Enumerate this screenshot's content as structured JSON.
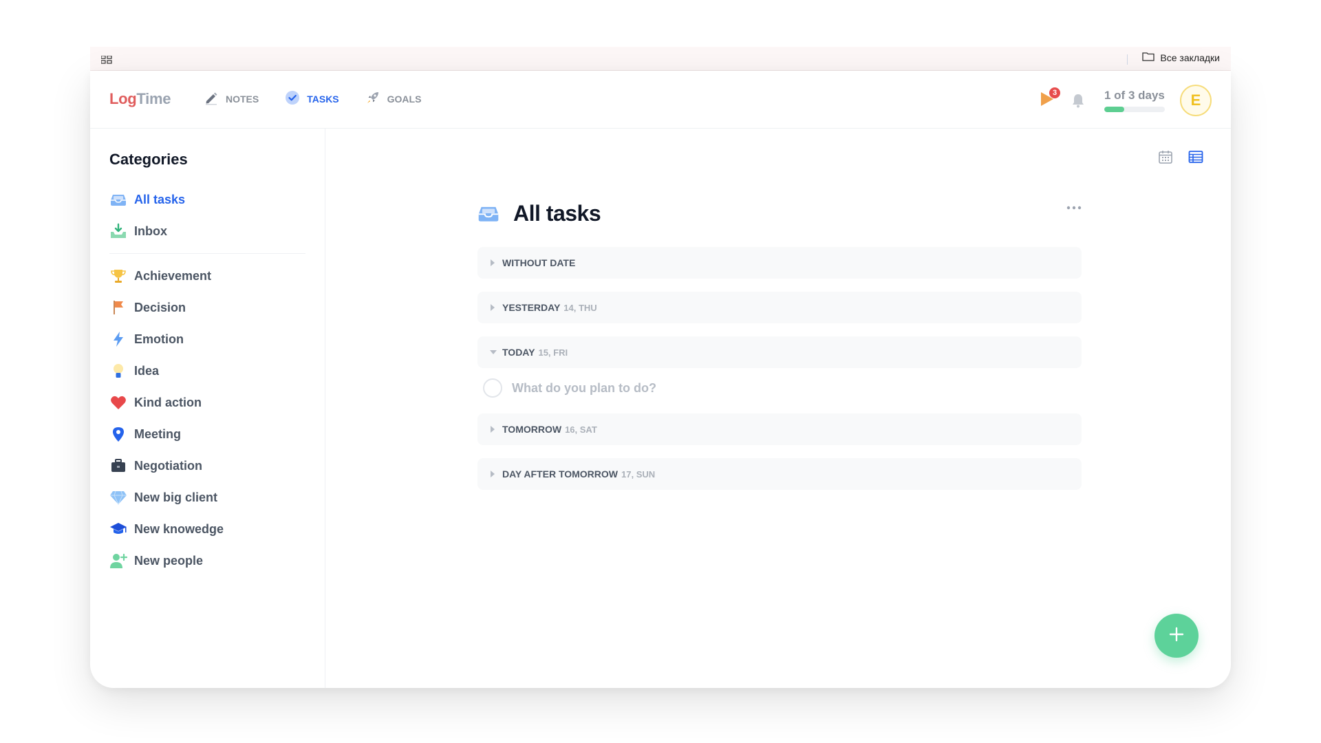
{
  "browser": {
    "all_bookmarks_label": "Все закладки"
  },
  "app": {
    "logo_part1": "Log",
    "logo_part2": "Time"
  },
  "nav": {
    "items": [
      {
        "label": "NOTES",
        "icon": "pencil-icon"
      },
      {
        "label": "TASKS",
        "icon": "check-circle-icon",
        "active": true
      },
      {
        "label": "GOALS",
        "icon": "rocket-icon"
      }
    ]
  },
  "header": {
    "notification_count": "3",
    "trial_text": "1 of 3 days",
    "trial_progress": 0.33,
    "avatar_letter": "E"
  },
  "sidebar": {
    "title": "Categories",
    "items": [
      {
        "label": "All tasks",
        "icon": "tray-icon",
        "active": true
      },
      {
        "label": "Inbox",
        "icon": "inbox-download-icon"
      },
      {
        "label": "Achievement",
        "icon": "trophy-icon"
      },
      {
        "label": "Decision",
        "icon": "flag-icon"
      },
      {
        "label": "Emotion",
        "icon": "lightning-icon"
      },
      {
        "label": "Idea",
        "icon": "lightbulb-icon"
      },
      {
        "label": "Kind action",
        "icon": "heart-icon"
      },
      {
        "label": "Meeting",
        "icon": "location-pin-icon"
      },
      {
        "label": "Negotiation",
        "icon": "briefcase-icon"
      },
      {
        "label": "New big client",
        "icon": "diamond-icon"
      },
      {
        "label": "New knowedge",
        "icon": "graduation-cap-icon"
      },
      {
        "label": "New people",
        "icon": "add-person-icon"
      }
    ]
  },
  "main": {
    "title": "All tasks",
    "groups": [
      {
        "name": "WITHOUT DATE",
        "date": "",
        "expanded": false
      },
      {
        "name": "YESTERDAY",
        "date": "14, THU",
        "expanded": false
      },
      {
        "name": "TODAY",
        "date": "15, FRI",
        "expanded": true
      },
      {
        "name": "TOMORROW",
        "date": "16, SAT",
        "expanded": false
      },
      {
        "name": "DAY AFTER TOMORROW",
        "date": "17, SUN",
        "expanded": false
      }
    ],
    "new_task_placeholder": "What do you plan to do?"
  },
  "colors": {
    "accent": "#2563eb",
    "brand_red": "#e05d5d",
    "success": "#5dd29a"
  }
}
